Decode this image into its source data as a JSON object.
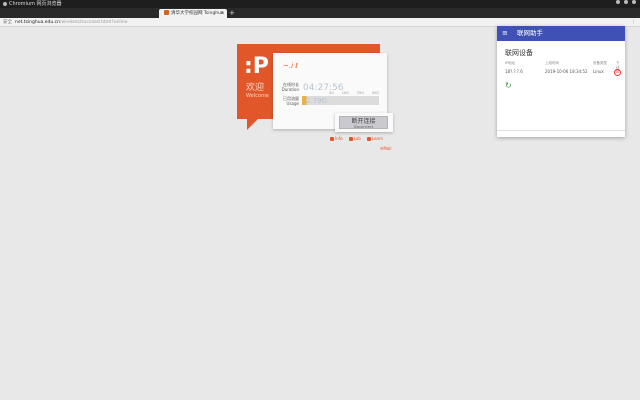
{
  "os_bar": {
    "app_name": "Chromium 网页浏览器"
  },
  "tabs": [
    {
      "label": "清华大学校园网 Tsinghua",
      "active": true
    }
  ],
  "address": {
    "secure_label": "安全",
    "host": "net.tsinghua.edu.cn",
    "path": "/wireless/succeed.html?online"
  },
  "portal": {
    "logo": ":P",
    "welcome_cn": "欢迎",
    "welcome_en": "Welcome",
    "user_sig": "~.i ℓ",
    "duration_label_cn": "在线时长",
    "duration_label_en": "Duration",
    "duration_value": "04:27:56",
    "usage_label_cn": "已用流量",
    "usage_label_en": "Usage",
    "usage_value": "2.79G",
    "usage_ticks": [
      "5G",
      "10G",
      "25G",
      "50G"
    ],
    "disconnect_cn": "断开连接",
    "disconnect_en": "Disconnect",
    "links": [
      "Info",
      "Lab",
      "Learn"
    ],
    "mail": "Mail"
  },
  "popup": {
    "title": "联网助手",
    "subtitle": "联网设备",
    "columns": {
      "ip": "IP地址",
      "time": "上线时间",
      "type": "设备类型",
      "offline": "下线"
    },
    "devices": [
      {
        "ip": "18?.?.?.6",
        "time": "2019-10-06 18:34:52",
        "type": "Linux"
      }
    ]
  },
  "colors": {
    "accent": "#e2572a",
    "popup_header": "#3f51b5"
  }
}
